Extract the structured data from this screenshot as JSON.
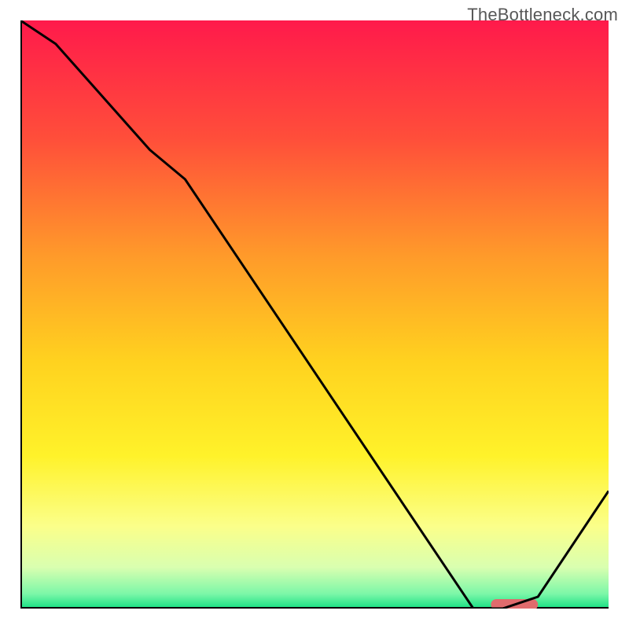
{
  "watermark": "TheBottleneck.com",
  "chart_data": {
    "type": "line",
    "title": "",
    "xlabel": "",
    "ylabel": "",
    "xlim": [
      0,
      100
    ],
    "ylim": [
      0,
      100
    ],
    "series": [
      {
        "name": "curve",
        "x": [
          0,
          6,
          22,
          28,
          77,
          82,
          88,
          100
        ],
        "y": [
          100,
          96,
          78,
          73,
          0,
          0,
          2,
          20
        ]
      }
    ],
    "marker": {
      "x_start": 80,
      "x_end": 88,
      "y": 0,
      "color": "#e06b6d"
    },
    "gradient_stops": [
      {
        "offset": 0.0,
        "color": "#ff1a4b"
      },
      {
        "offset": 0.2,
        "color": "#ff4e3a"
      },
      {
        "offset": 0.4,
        "color": "#ff9a2a"
      },
      {
        "offset": 0.58,
        "color": "#ffd21f"
      },
      {
        "offset": 0.74,
        "color": "#fff22a"
      },
      {
        "offset": 0.86,
        "color": "#fbff8a"
      },
      {
        "offset": 0.93,
        "color": "#d9ffb0"
      },
      {
        "offset": 0.975,
        "color": "#7cf7a8"
      },
      {
        "offset": 1.0,
        "color": "#17e083"
      }
    ],
    "axis_color": "#000000",
    "curve_color": "#000000"
  }
}
